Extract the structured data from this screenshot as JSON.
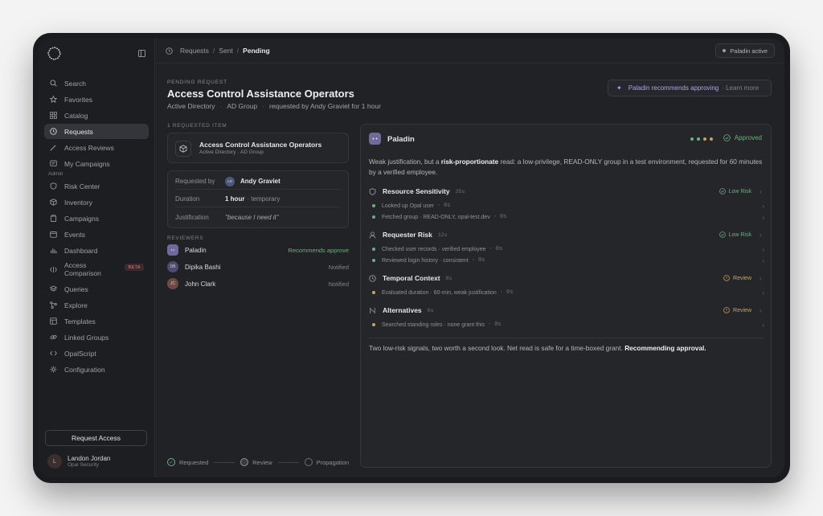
{
  "sidebar": {
    "nav": [
      "Search",
      "Favorites",
      "Catalog",
      "Requests",
      "Access Reviews",
      "My Campaigns"
    ],
    "admin_label": "Admin",
    "admin": [
      "Risk Center",
      "Inventory",
      "Campaigns",
      "Events",
      "Dashboard",
      "Access Comparison",
      "Queries",
      "Explore",
      "Templates",
      "Linked Groups",
      "OpalScript",
      "Configuration"
    ],
    "beta": "BETA",
    "request_access": "Request Access",
    "user": {
      "initial": "L",
      "name": "Landon Jordan",
      "org": "Opal Security"
    }
  },
  "header": {
    "crumbs": [
      "Requests",
      "Sent",
      "Pending"
    ],
    "paladin_status": "Paladin active"
  },
  "request": {
    "kicker": "PENDING REQUEST",
    "title": "Access Control Assistance Operators",
    "sub_source": "Active Directory",
    "sub_type": "AD Group",
    "sub_requested": "requested by Andy Graviet for 1 hour",
    "recommend_text": "Paladin recommends approving",
    "recommend_link": "· Learn more",
    "items_label": "1 REQUESTED ITEM",
    "item": {
      "title": "Access Control Assistance Operators",
      "sub": "Active Directory · AD Group"
    },
    "requested_by_k": "Requested by",
    "requested_by_initials": "AG",
    "requested_by_v": "Andy Graviet",
    "duration_k": "Duration",
    "duration_v": "1 hour",
    "duration_m": "· temporary",
    "justification_k": "Justification",
    "justification_v": "\"because I need it\"",
    "reviewers_label": "REVIEWERS",
    "reviewers": [
      {
        "initials": "",
        "name": "Paladin",
        "status": "Recommends approve"
      },
      {
        "initials": "DB",
        "name": "Dipika Bashi",
        "status": "Notified"
      },
      {
        "initials": "JC",
        "name": "John Clark",
        "status": "Notified"
      }
    ],
    "steps": [
      "Requested",
      "Review",
      "Propagation"
    ]
  },
  "paladin": {
    "name": "Paladin",
    "status": "Approved",
    "summary_pre": "Weak justification, but a ",
    "summary_bold": "risk-proportionate",
    "summary_post": " read: a low-privilege, READ-ONLY group in a test environment, requested for 60 minutes by a verified employee.",
    "groups": [
      {
        "title": "Resource Sensitivity",
        "dur": "35s",
        "badge": "Low Risk",
        "rows": [
          {
            "text": "Looked up Opal user",
            "t": "0s"
          },
          {
            "text": "Fetched group · READ-ONLY, opal-test.dev",
            "t": "0s"
          }
        ]
      },
      {
        "title": "Requester Risk",
        "dur": "12s",
        "badge": "Low Risk",
        "rows": [
          {
            "text": "Checked user records · verified employee",
            "t": "0s"
          },
          {
            "text": "Reviewed login history · consistent",
            "t": "0s"
          }
        ]
      },
      {
        "title": "Temporal Context",
        "dur": "8s",
        "badge": "Review",
        "rows": [
          {
            "text": "Evaluated duration · 60-min, weak justification",
            "t": "0s"
          }
        ]
      },
      {
        "title": "Alternatives",
        "dur": "6s",
        "badge": "Review",
        "rows": [
          {
            "text": "Searched standing roles · none grant this",
            "t": "0s"
          }
        ]
      }
    ],
    "conclusion_pre": "Two low-risk signals, two worth a second look. Net read is safe for a time-boxed grant. ",
    "conclusion_bold": "Recommending approval."
  },
  "colors": {
    "accent": "#aaa7e0",
    "success": "#6fae7e",
    "warning": "#c8a45e",
    "active_nav": "#33353a"
  }
}
